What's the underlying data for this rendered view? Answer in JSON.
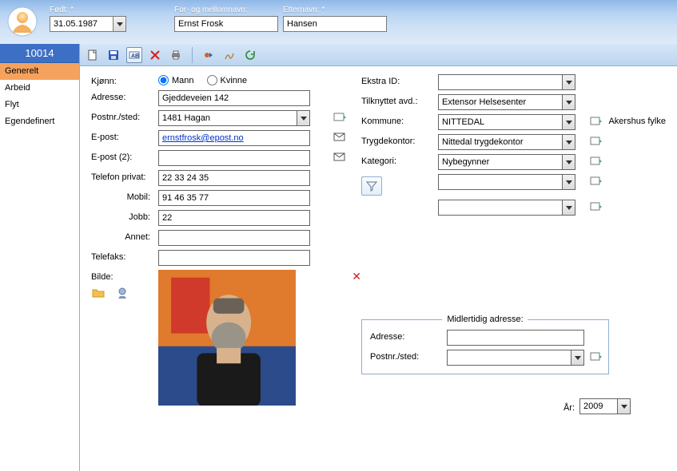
{
  "header": {
    "dob_label": "Født: *",
    "dob_value": "31.05.1987",
    "firstname_label": "For- og mellomnavn:",
    "firstname_value": "Ernst Frosk",
    "lastname_label": "Etternavn: *",
    "lastname_value": "Hansen"
  },
  "sidebar": {
    "record_id": "10014",
    "items": [
      {
        "label": "Generelt",
        "active": true
      },
      {
        "label": "Arbeid",
        "active": false
      },
      {
        "label": "Flyt",
        "active": false
      },
      {
        "label": "Egendefinert",
        "active": false
      }
    ]
  },
  "toolbar": {
    "buttons": [
      "new",
      "save",
      "rename",
      "delete",
      "print",
      "_sep",
      "transfer",
      "sign",
      "refresh"
    ]
  },
  "form": {
    "left": {
      "gender_label": "Kjønn:",
      "gender_male": "Mann",
      "gender_female": "Kvinne",
      "gender_value": "Mann",
      "address_label": "Adresse:",
      "address_value": "Gjeddeveien 142",
      "postal_label": "Postnr./sted:",
      "postal_value": "1481 Hagan",
      "email_label": "E-post:",
      "email_value": "ernstfrosk@epost.no",
      "email2_label": "E-post (2):",
      "email2_value": "",
      "phone_private_label": "Telefon privat:",
      "phone_private_value": "22 33 24 35",
      "mobile_label": "Mobil:",
      "mobile_value": "91 46 35 77",
      "work_label": "Jobb:",
      "work_value": "22",
      "other_label": "Annet:",
      "other_value": "",
      "fax_label": "Telefaks:",
      "fax_value": "",
      "image_label": "Bilde:"
    },
    "right": {
      "extra_id_label": "Ekstra ID:",
      "extra_id_value": "",
      "dept_label": "Tilknyttet avd.:",
      "dept_value": "Extensor Helsesenter",
      "municipality_label": "Kommune:",
      "municipality_value": "NITTEDAL",
      "county_value": "Akershus fylke",
      "social_office_label": "Trygdekontor:",
      "social_office_value": "Nittedal trygdekontor",
      "category_label": "Kategori:",
      "category_value": "Nybegynner",
      "extra1_value": "",
      "extra2_value": ""
    },
    "temp_address": {
      "legend": "Midlertidig adresse:",
      "address_label": "Adresse:",
      "address_value": "",
      "postal_label": "Postnr./sted:",
      "postal_value": ""
    },
    "year": {
      "label": "År:",
      "value": "2009"
    }
  }
}
